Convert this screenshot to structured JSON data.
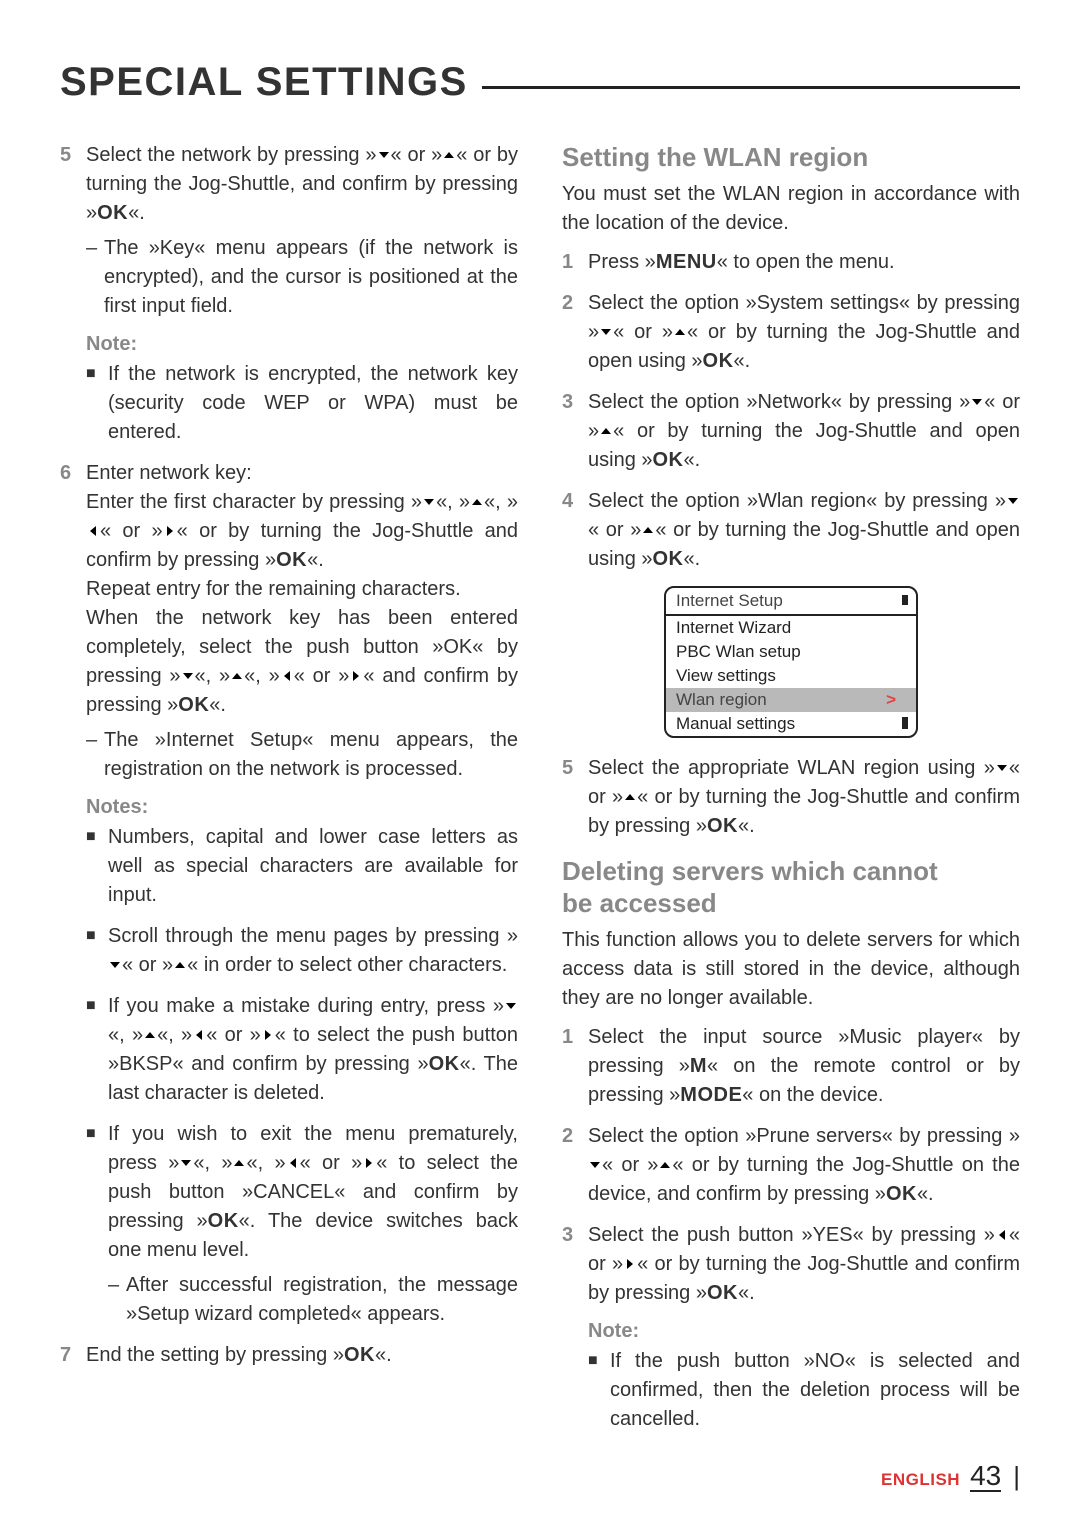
{
  "title": "SPECIAL SETTINGS",
  "left": {
    "step5": {
      "num": "5",
      "text_a": "Select the network by pressing »",
      "text_b": "« or »",
      "text_c": "« or by turning the Jog-Shuttle, and confirm by pressing »",
      "ok": "OK",
      "text_d": "«.",
      "sub": "The »Key« menu appears (if the network is encrypted), and the cursor is positioned at the first input field."
    },
    "note1_label": "Note:",
    "note1_text": "If the network is encrypted, the network key (security code WEP or WPA) must be entered.",
    "step6": {
      "num": "6",
      "lead": "Enter network key:",
      "p1_a": "Enter the first character by pressing »",
      "p1_b": "«, »",
      "p1_c": "«, »",
      "p1_d": "« or »",
      "p1_e": "« or by turning the Jog-Shuttle and confirm by pressing »",
      "ok": "OK",
      "p1_f": "«.",
      "p2": "Repeat entry for the remaining characters.",
      "p3_a": "When the network key has been entered completely, select the push button »OK« by pressing »",
      "p3_b": "«, »",
      "p3_c": "«, »",
      "p3_d": "« or »",
      "p3_e": "« and confirm by pressing »",
      "p3_ok": "OK",
      "p3_f": "«.",
      "sub": "The »Internet Setup« menu appears, the registration on the network is processed."
    },
    "notes_label": "Notes:",
    "notes_b1": "Numbers, capital and lower case letters as well as special characters are available for input.",
    "notes_b2_a": "Scroll through the menu pages by pressing »",
    "notes_b2_b": "« or »",
    "notes_b2_c": "« in order to select other characters.",
    "notes_b3_a": "If you make a mistake during entry, press »",
    "notes_b3_b": "«, »",
    "notes_b3_c": "«, »",
    "notes_b3_d": "« or »",
    "notes_b3_e": "« to select the push button »BKSP« and confirm by pressing »",
    "notes_b3_ok": "OK",
    "notes_b3_f": "«. The last character is deleted.",
    "notes_b4_a": "If you wish to exit the menu prematurely, press »",
    "notes_b4_b": "«, »",
    "notes_b4_c": "«, »",
    "notes_b4_d": "« or »",
    "notes_b4_e": "« to select the push button »CANCEL« and confirm by pressing »",
    "notes_b4_ok": "OK",
    "notes_b4_f": "«. The device switches back one menu level.",
    "notes_sub": "After successful registration, the message »Setup wizard completed« appears.",
    "step7": {
      "num": "7",
      "text_a": "End the setting by pressing »",
      "ok": "OK",
      "text_b": "«."
    }
  },
  "right": {
    "h1": "Setting the WLAN region",
    "intro1": "You must set the WLAN region in accordance with the location of the device.",
    "s1_num": "1",
    "s1_a": "Press »",
    "s1_menu": "MENU",
    "s1_b": "« to open the menu.",
    "s2_num": "2",
    "s2_a": "Select the option »System settings« by pressing »",
    "s2_b": "« or »",
    "s2_c": "« or by turning the Jog-Shuttle and open using »",
    "s2_ok": "OK",
    "s2_d": "«.",
    "s3_num": "3",
    "s3_a": "Select the option »Network« by pressing »",
    "s3_b": "« or »",
    "s3_c": "« or by turning the Jog-Shuttle and open using »",
    "s3_ok": "OK",
    "s3_d": "«.",
    "s4_num": "4",
    "s4_a": "Select the option »Wlan region« by pressing »",
    "s4_b": "« or »",
    "s4_c": "« or by turning the Jog-Shuttle and open using »",
    "s4_ok": "OK",
    "s4_d": "«.",
    "menu": {
      "header": "Internet Setup",
      "r1": "Internet Wizard",
      "r2": "PBC Wlan setup",
      "r3": "View settings",
      "r4": "Wlan region",
      "r4_chevron": ">",
      "r5": "Manual settings"
    },
    "s5_num": "5",
    "s5_a": "Select the appropriate WLAN region using »",
    "s5_b": "« or »",
    "s5_c": "« or by turning the Jog-Shuttle and confirm by pressing »",
    "s5_ok": "OK",
    "s5_d": "«.",
    "h2a": "Deleting servers which cannot",
    "h2b": "be accessed",
    "intro2": "This function allows you to delete servers for which access data is still stored in the device, although they are no longer available.",
    "d1_num": "1",
    "d1_a": "Select the input source »Music player« by pressing »",
    "d1_m": "M",
    "d1_b": "« on the remote control or by pressing »",
    "d1_mode": "MODE",
    "d1_c": "« on the device.",
    "d2_num": "2",
    "d2_a": "Select the option »Prune servers« by pressing »",
    "d2_b": "« or »",
    "d2_c": "« or by turning the Jog-Shuttle on the device, and confirm by pressing »",
    "d2_ok": "OK",
    "d2_d": "«.",
    "d3_num": "3",
    "d3_a": "Select the push button »YES« by pressing »",
    "d3_b": "« or »",
    "d3_c": "« or by turning the Jog-Shuttle and confirm by pressing »",
    "d3_ok": "OK",
    "d3_d": "«.",
    "note2_label": "Note:",
    "note2_text": "If the push button »NO« is selected and confirmed, then the deletion process will be cancelled."
  },
  "footer": {
    "lang": "ENGLISH",
    "page": "43"
  }
}
